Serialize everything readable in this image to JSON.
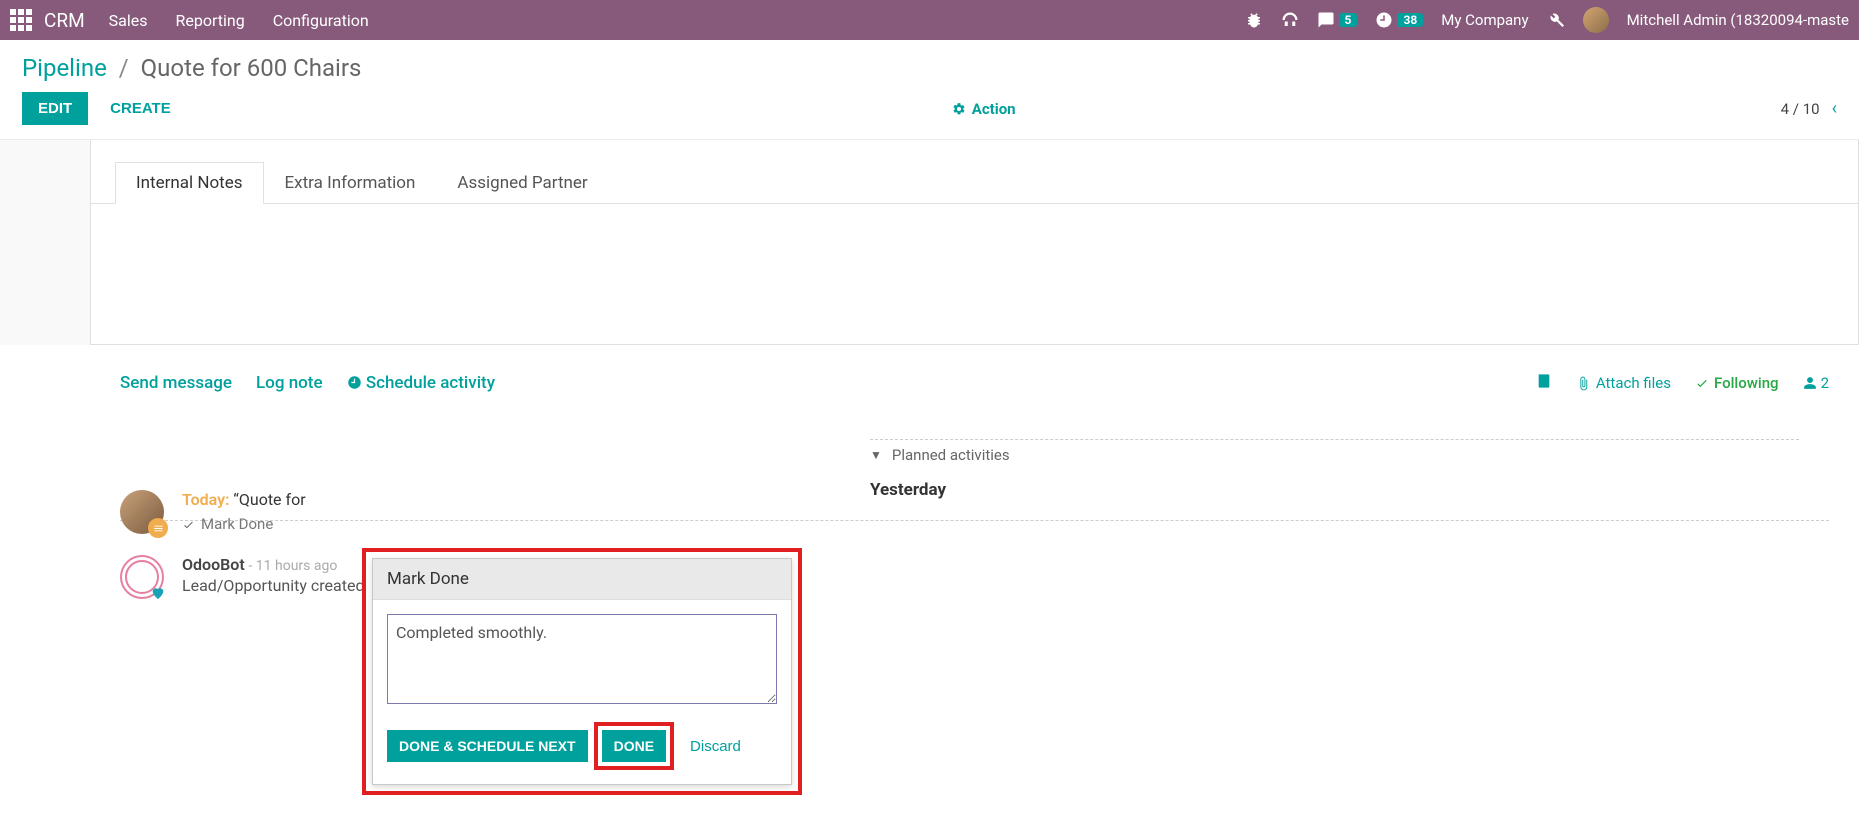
{
  "nav": {
    "brand": "CRM",
    "links": [
      "Sales",
      "Reporting",
      "Configuration"
    ],
    "msg_badge": "5",
    "clock_badge": "38",
    "company": "My Company",
    "user": "Mitchell Admin (18320094-maste"
  },
  "breadcrumb": {
    "root": "Pipeline",
    "leaf": "Quote for 600 Chairs"
  },
  "buttons": {
    "edit": "EDIT",
    "create": "CREATE",
    "action": "Action"
  },
  "pager": {
    "text": "4 / 10"
  },
  "tabs": [
    "Internal Notes",
    "Extra Information",
    "Assigned Partner"
  ],
  "chatter": {
    "links": {
      "send": "Send message",
      "log": "Log note",
      "schedule": "Schedule activity"
    },
    "attach": "Attach files",
    "following": "Following",
    "follower_count": "2",
    "planned_header": "Planned activities"
  },
  "activity": {
    "today_label": "Today:",
    "today_text": "“Quote for",
    "mark_done": "Mark Done"
  },
  "popover": {
    "title": "Mark Done",
    "text": "Completed smoothly. ",
    "btn_next": "DONE & SCHEDULE NEXT",
    "btn_done": "DONE",
    "discard": "Discard"
  },
  "yesterday": {
    "label": "Yesterday",
    "bot": "OdooBot",
    "time": "- 11 hours ago",
    "msg": "Lead/Opportunity created"
  }
}
